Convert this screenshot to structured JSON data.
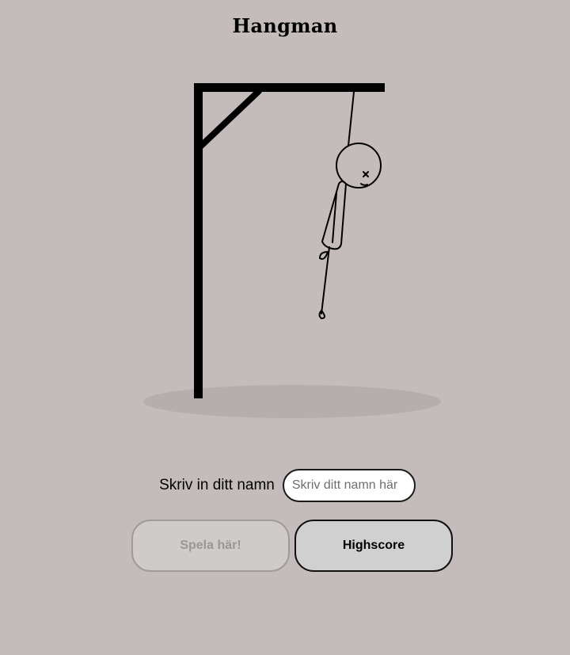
{
  "page": {
    "title": "Hangman"
  },
  "game": {
    "state": "hanged",
    "figure_icon": "hanged-stick-figure"
  },
  "name_form": {
    "label": "Skriv in ditt namn",
    "input_value": "",
    "input_placeholder": "Skriv ditt namn här"
  },
  "buttons": {
    "play_label": "Spela här!",
    "play_enabled": false,
    "highscore_label": "Highscore"
  },
  "colors": {
    "background": "#c4bcba",
    "shadow": "#b6aeac",
    "gallows": "#000000",
    "button_disabled_bg": "#cfcbca",
    "button_bg": "#d0d0d0"
  }
}
